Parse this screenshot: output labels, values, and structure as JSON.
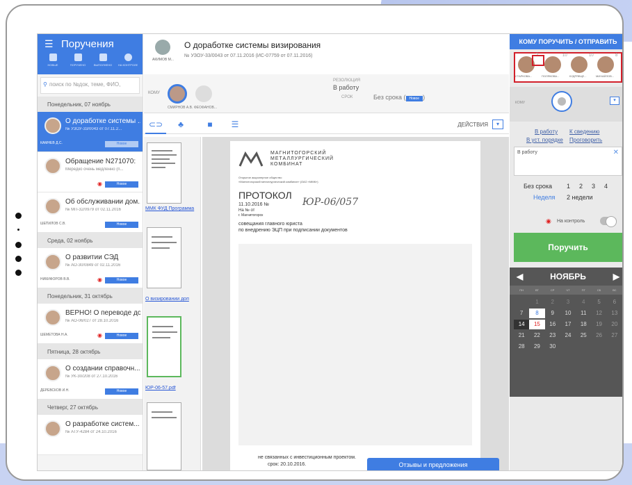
{
  "sidebar": {
    "title": "Поручения",
    "tools": [
      "НОВЫЕ",
      "ПОРУЧЕНО",
      "ВЫПОЛНЕНО",
      "НА КОНТРОЛЕ"
    ],
    "search_placeholder": "поиск по №док, теме, ФИО,",
    "groups": [
      {
        "day": "Понедельник, 07 ноябрь",
        "items": [
          {
            "title": "О доработке системы ...",
            "num": "№ УЗОУ-33/0043 от 07.11.2...",
            "who": "КАМНЕВ Д.С.",
            "badge": "Новое",
            "active": true
          },
          {
            "title": "Обращение N271070:",
            "num": "Мередко очень медленно (п...",
            "who": "",
            "badge": "Новое",
            "eye": true
          },
          {
            "title": "Об обслуживании дом...",
            "num": "№ МП-32/0979 от 02.11.2016",
            "who": "ШЕПИЛОВ С.В.",
            "badge": "Новое"
          }
        ]
      },
      {
        "day": "Среда, 02 ноябрь",
        "items": [
          {
            "title": "О развитии СЭД",
            "num": "№ АО-30/0849 от 02.11.2016",
            "who": "НИКИФОРОВ В.В.",
            "badge": "Новое",
            "eye": true
          }
        ]
      },
      {
        "day": "Понедельник, 31 октябрь",
        "items": [
          {
            "title": "ВЕРНО! О переводе до...",
            "num": "№ АО-06/027 от 28.10.2016",
            "who": "ШЕМЕТОВА Н.А.",
            "badge": "Новое",
            "eye": true
          }
        ]
      },
      {
        "day": "Пятница, 28 октябрь",
        "items": [
          {
            "title": "О создании справочн...",
            "num": "№ УК-30/208 от 27.10.2016",
            "who": "ДЕРЕВСКОВ И.Н.",
            "badge": "Новое"
          }
        ]
      },
      {
        "day": "Четверг, 27 октябрь",
        "items": [
          {
            "title": "О разработке систем...",
            "num": "№ АТУ-4284 от 24.10.2016",
            "who": "",
            "badge": ""
          }
        ]
      }
    ]
  },
  "doc": {
    "author": "АКИМОВ М...",
    "title": "О доработке системы визирования",
    "number": "№ УЗОУ-33/0043 от 07.11.2016 (ИС-07759 от 07.11.2016)",
    "komu_label": "КОМУ",
    "recipients": [
      "СМИРНОВ А.В.",
      "ФЕОФАНОВ..."
    ],
    "resolution_label": "РЕЗОЛЮЦИЯ",
    "resolution": "В работу",
    "srok_label": "СРОК",
    "srok": "Без срока (",
    "srok_badge": "Новое",
    "srok_tail": ")",
    "actions": "ДЕЙСТВИЯ",
    "thumbs": [
      "ММК ФУД Программа",
      "О визировании доп",
      "ЮР-06-57.pdf"
    ],
    "page": {
      "comp": "МАГНИТОГОРСКИЙ\nМЕТАЛЛУРГИЧЕСКИЙ\nКОМБИНАТ",
      "org": "Открытое акционерное общество",
      "org2": "«Магнитогорский металлургический комбинат» (ОАО «ММК»)",
      "protocol": "ПРОТОКОЛ",
      "date": "11.10.2016   №",
      "hand": "ЮР-06/057",
      "na": "На №             от",
      "city": "г. Магнитогорск",
      "l1": "совещания главного юриста",
      "l2": "по внедрению ЭЦП при подписании документов",
      "b1": "не связанных с инвестиционным проектом.",
      "b2": "срок: 20.10.2016."
    },
    "feedback": "Отзывы и предложения"
  },
  "right": {
    "header": "КОМУ ПОРУЧИТЬ / ОТПРАВИТЬ",
    "people": [
      {
        "n": "СТАРКОВА...",
        "c": "7"
      },
      {
        "n": "ПОЛЯКОВА...",
        "c": "10"
      },
      {
        "n": "КУДРЯВЦЕ...",
        "c": "10"
      },
      {
        "n": "МИХАЙЛОВ...",
        "c": "8"
      }
    ],
    "komu": "КОМУ",
    "link1": "В работу",
    "link2": "К сведению",
    "link3": "В уст. порядке",
    "link4": "Проговорить",
    "text": "В работу",
    "terms1": [
      "Без срока",
      "1",
      "2",
      "3",
      "4"
    ],
    "terms2": [
      "Неделя",
      "2 недели"
    ],
    "control": "На контроль",
    "send": "Поручить",
    "month": "НОЯБРЬ",
    "wd": [
      "ПН",
      "ВТ",
      "СР",
      "ЧТ",
      "ПТ",
      "СБ",
      "ВС"
    ]
  },
  "colors": {
    "accent": "#3f7de2",
    "danger": "#e02020",
    "ok": "#5cb85c"
  }
}
